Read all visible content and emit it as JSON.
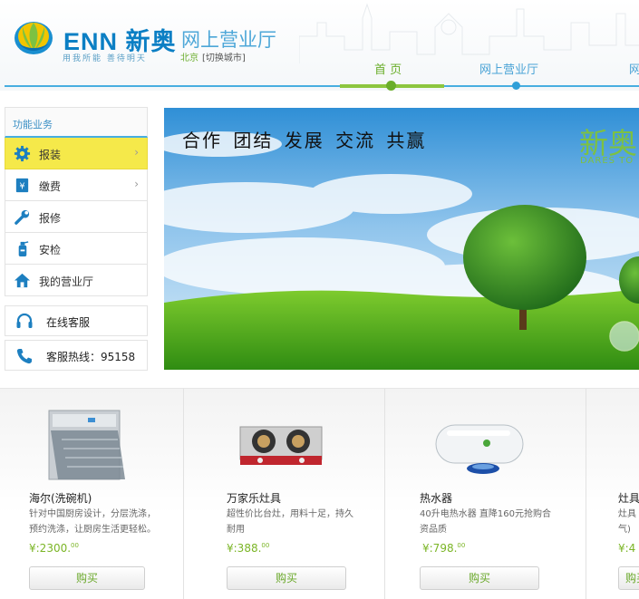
{
  "header": {
    "logo_text": "ENN",
    "logo_cn": "新奥",
    "slogan": "用我所能 善待明天",
    "site_title": "网上营业厅",
    "city": "北京",
    "switch_city": "[切换城市]"
  },
  "nav": {
    "items": [
      {
        "label": "首 页",
        "active": true
      },
      {
        "label": "网上营业厅",
        "active": false
      },
      {
        "label": "网",
        "active": false
      }
    ]
  },
  "sidebar": {
    "title": "功能业务",
    "items": [
      {
        "label": "报装",
        "icon": "gear-icon",
        "active": true,
        "arrow": "›"
      },
      {
        "label": "缴费",
        "icon": "bill-icon",
        "active": false,
        "arrow": "›"
      },
      {
        "label": "报修",
        "icon": "wrench-icon",
        "active": false,
        "arrow": ""
      },
      {
        "label": "安检",
        "icon": "extinguisher-icon",
        "active": false,
        "arrow": ""
      },
      {
        "label": "我的营业厅",
        "icon": "house-icon",
        "active": false,
        "arrow": ""
      }
    ],
    "online_service": "在线客服",
    "hotline": "客服热线：95158"
  },
  "banner": {
    "slogan": "合作 团结 发展 交流 共赢",
    "brand": "新奥",
    "sub": "DARES TO"
  },
  "products": [
    {
      "name": "海尔(洗碗机)",
      "desc": [
        "针对中国厨房设计，分层洗涤，",
        "预约洗涤，让厨房生活更轻松。"
      ],
      "price_main": "¥:2300.",
      "price_cents": "00",
      "buy": "购买",
      "image": "dishwasher"
    },
    {
      "name": "万家乐灶具",
      "desc": [
        "超性价比台灶，用料十足，持久",
        "耐用"
      ],
      "price_main": "¥:388.",
      "price_cents": "00",
      "buy": "购买",
      "image": "gas-stove"
    },
    {
      "name": "热水器",
      "desc": [
        "40升电热水器 直降160元抢购合",
        "资品质"
      ],
      "price_main": "¥:798.",
      "price_cents": "00",
      "buy": "购买",
      "image": "water-heater"
    },
    {
      "name": "灶具",
      "desc": [
        "灶具",
        "气)"
      ],
      "price_main": "¥:4",
      "price_cents": "",
      "buy": "购买",
      "image": "partial"
    }
  ],
  "colors": {
    "brand_blue": "#0b7fc4",
    "nav_line": "#47aee0",
    "accent_green": "#7bb526",
    "active_yellow": "#f5e94a"
  }
}
